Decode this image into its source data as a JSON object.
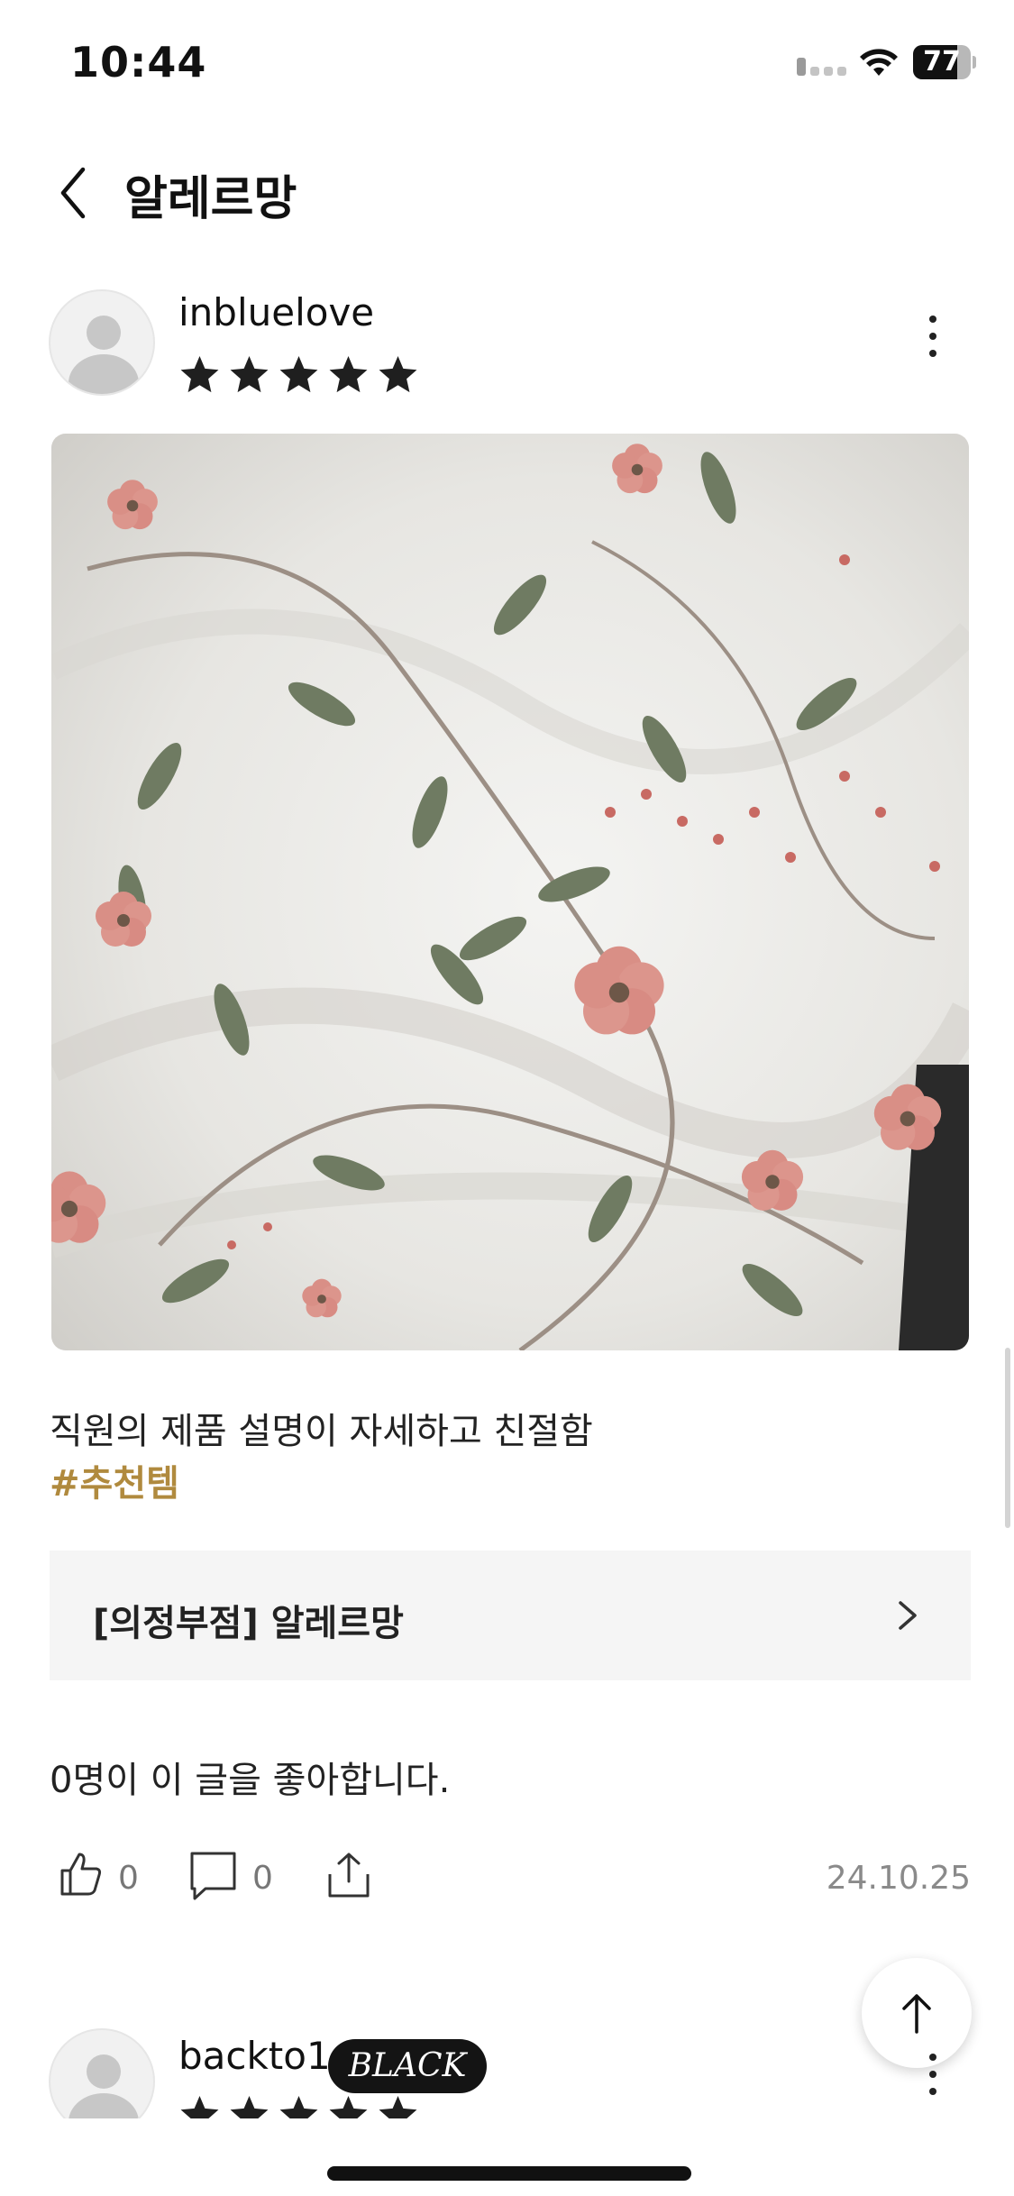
{
  "status_bar": {
    "time": "10:44",
    "battery_level": "77"
  },
  "header": {
    "title": "알레르망",
    "back_icon": "chevron-left-icon"
  },
  "review": {
    "username": "inbluelove",
    "rating": 5,
    "max_rating": 5,
    "photo": "floral-bedding-photo",
    "text": "직원의 제품 설명이 자세하고 친절함",
    "hashtag": "#추천템",
    "store_link_label": "[의정부점] 알레르망",
    "likes_summary": "0명이 이 글을 좋아합니다.",
    "like_count": "0",
    "comment_count": "0",
    "date": "24.10.25",
    "icons": {
      "like": "thumbs-up-icon",
      "comment": "comment-icon",
      "share": "share-icon",
      "more": "more-vertical-icon"
    }
  },
  "next_review": {
    "username": "backto1",
    "badge": "BLACK"
  },
  "scroll_top_icon": "arrow-up-icon",
  "colors": {
    "hashtag": "#b08a3e",
    "store_link_bg": "#f5f5f5",
    "badge_bg": "#141414"
  }
}
